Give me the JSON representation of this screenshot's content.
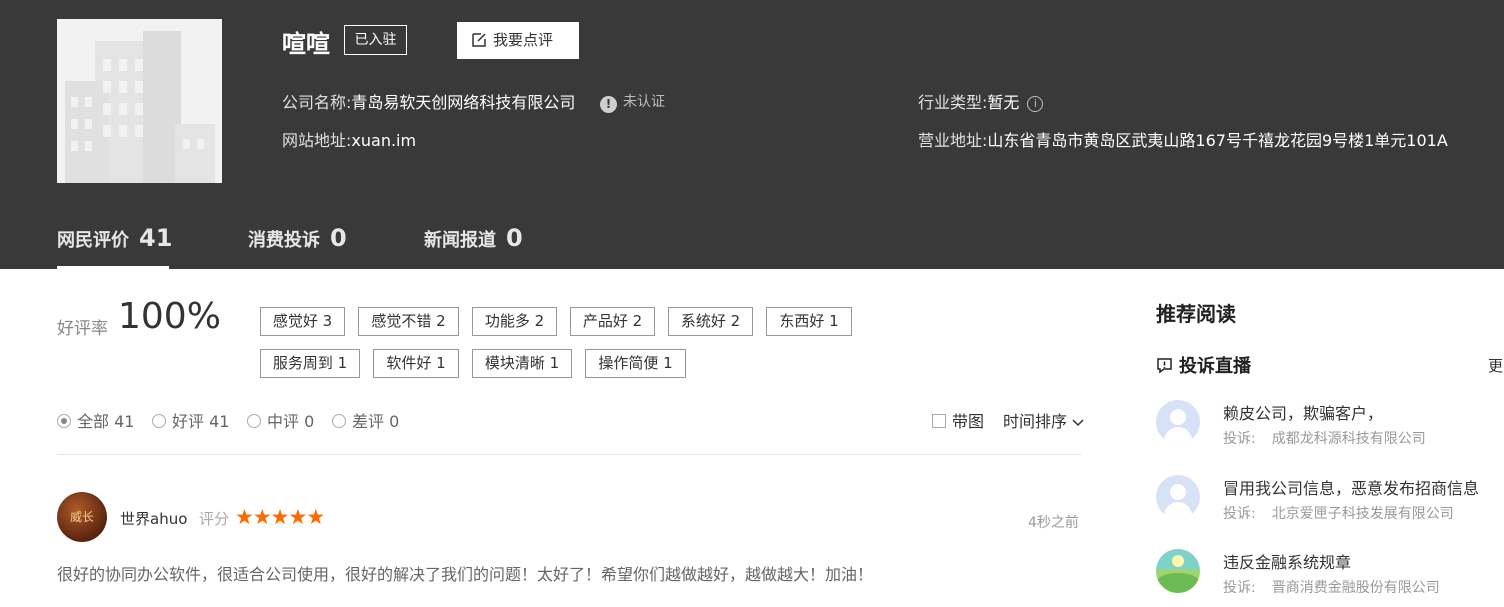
{
  "company": {
    "name": "喧喧",
    "badge": "已入驻",
    "review_button": "我要点评",
    "company_name_label": "公司名称:",
    "company_name_value": "青岛易软天创网络科技有限公司",
    "verify_status": "未认证",
    "website_label": "网站地址:",
    "website_value": "xuan.im",
    "industry_label": "行业类型:",
    "industry_value": "暂无",
    "address_label": "营业地址:",
    "address_value": "山东省青岛市黄岛区武夷山路167号千禧龙花园9号楼1单元101A"
  },
  "tabs": [
    {
      "label": "网民评价",
      "count": "41"
    },
    {
      "label": "消费投诉",
      "count": "0"
    },
    {
      "label": "新闻报道",
      "count": "0"
    }
  ],
  "rating": {
    "label": "好评率",
    "value": "100%"
  },
  "tags": [
    "感觉好 3",
    "感觉不错 2",
    "功能多 2",
    "产品好 2",
    "系统好 2",
    "东西好 1",
    "服务周到 1",
    "软件好 1",
    "模块清晰 1",
    "操作简便 1"
  ],
  "filters": [
    {
      "label": "全部",
      "count": "41"
    },
    {
      "label": "好评",
      "count": "41"
    },
    {
      "label": "中评",
      "count": "0"
    },
    {
      "label": "差评",
      "count": "0"
    }
  ],
  "options": {
    "with_image": "带图",
    "sort": "时间排序"
  },
  "review": {
    "avatar_text": "威长",
    "user": "世界ahuo",
    "score_label": "评分",
    "stars": 5,
    "time": "4秒之前",
    "text": "很好的协同办公软件，很适合公司使用，很好的解决了我们的问题！太好了！希望你们越做越好，越做越大！加油！"
  },
  "sidebar": {
    "title": "推荐阅读",
    "live_title": "投诉直播",
    "more": "更",
    "items": [
      {
        "title": "赖皮公司，欺骗客户，",
        "sub_label": "投诉:",
        "company": "成都龙科源科技有限公司"
      },
      {
        "title": "冒用我公司信息，恶意发布招商信息",
        "sub_label": "投诉:",
        "company": "北京爱匣子科技发展有限公司"
      },
      {
        "title": "违反金融系统规章",
        "sub_label": "投诉:",
        "company": "晋商消费金融股份有限公司"
      }
    ]
  },
  "colors": {
    "header_bg": "#3a393a",
    "star": "#ff6a00"
  }
}
